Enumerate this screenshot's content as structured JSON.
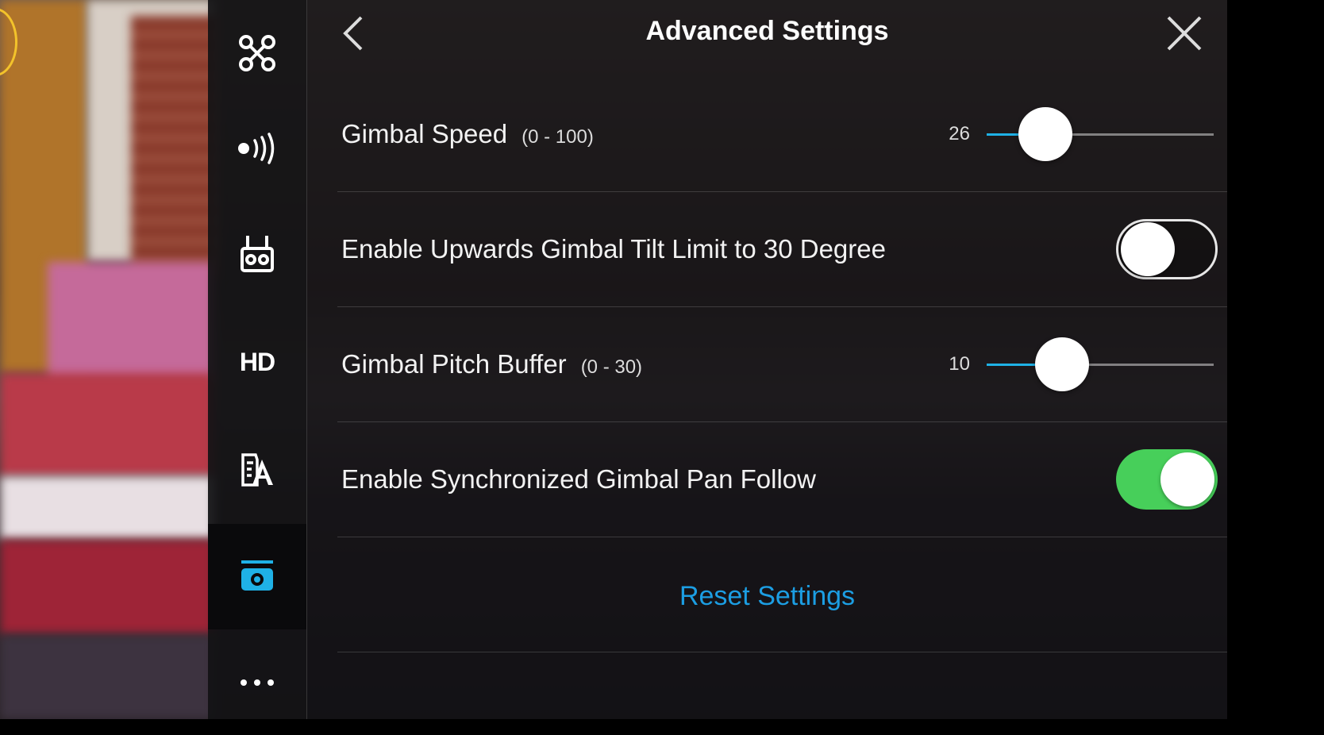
{
  "header": {
    "title": "Advanced Settings"
  },
  "sidebar": {
    "items": [
      {
        "icon": "drone-icon"
      },
      {
        "icon": "signal-icon"
      },
      {
        "icon": "remote-controller-icon"
      },
      {
        "label": "HD"
      },
      {
        "icon": "battery-icon"
      },
      {
        "icon": "gimbal-camera-icon"
      },
      {
        "icon": "more-icon"
      }
    ]
  },
  "settings": {
    "gimbal_speed": {
      "label": "Gimbal Speed",
      "range": "(0 - 100)",
      "value": "26",
      "fraction": 0.26
    },
    "tilt_limit": {
      "label": "Enable Upwards Gimbal Tilt Limit to 30 Degree",
      "enabled": false
    },
    "pitch_buffer": {
      "label": "Gimbal Pitch Buffer",
      "range": "(0 - 30)",
      "value": "10",
      "fraction": 0.333
    },
    "pan_follow": {
      "label": "Enable Synchronized Gimbal Pan Follow",
      "enabled": true
    }
  },
  "reset_label": "Reset Settings",
  "colors": {
    "accent": "#1fb1e6",
    "toggle_on": "#47cf5a",
    "link": "#1c9ee3"
  }
}
